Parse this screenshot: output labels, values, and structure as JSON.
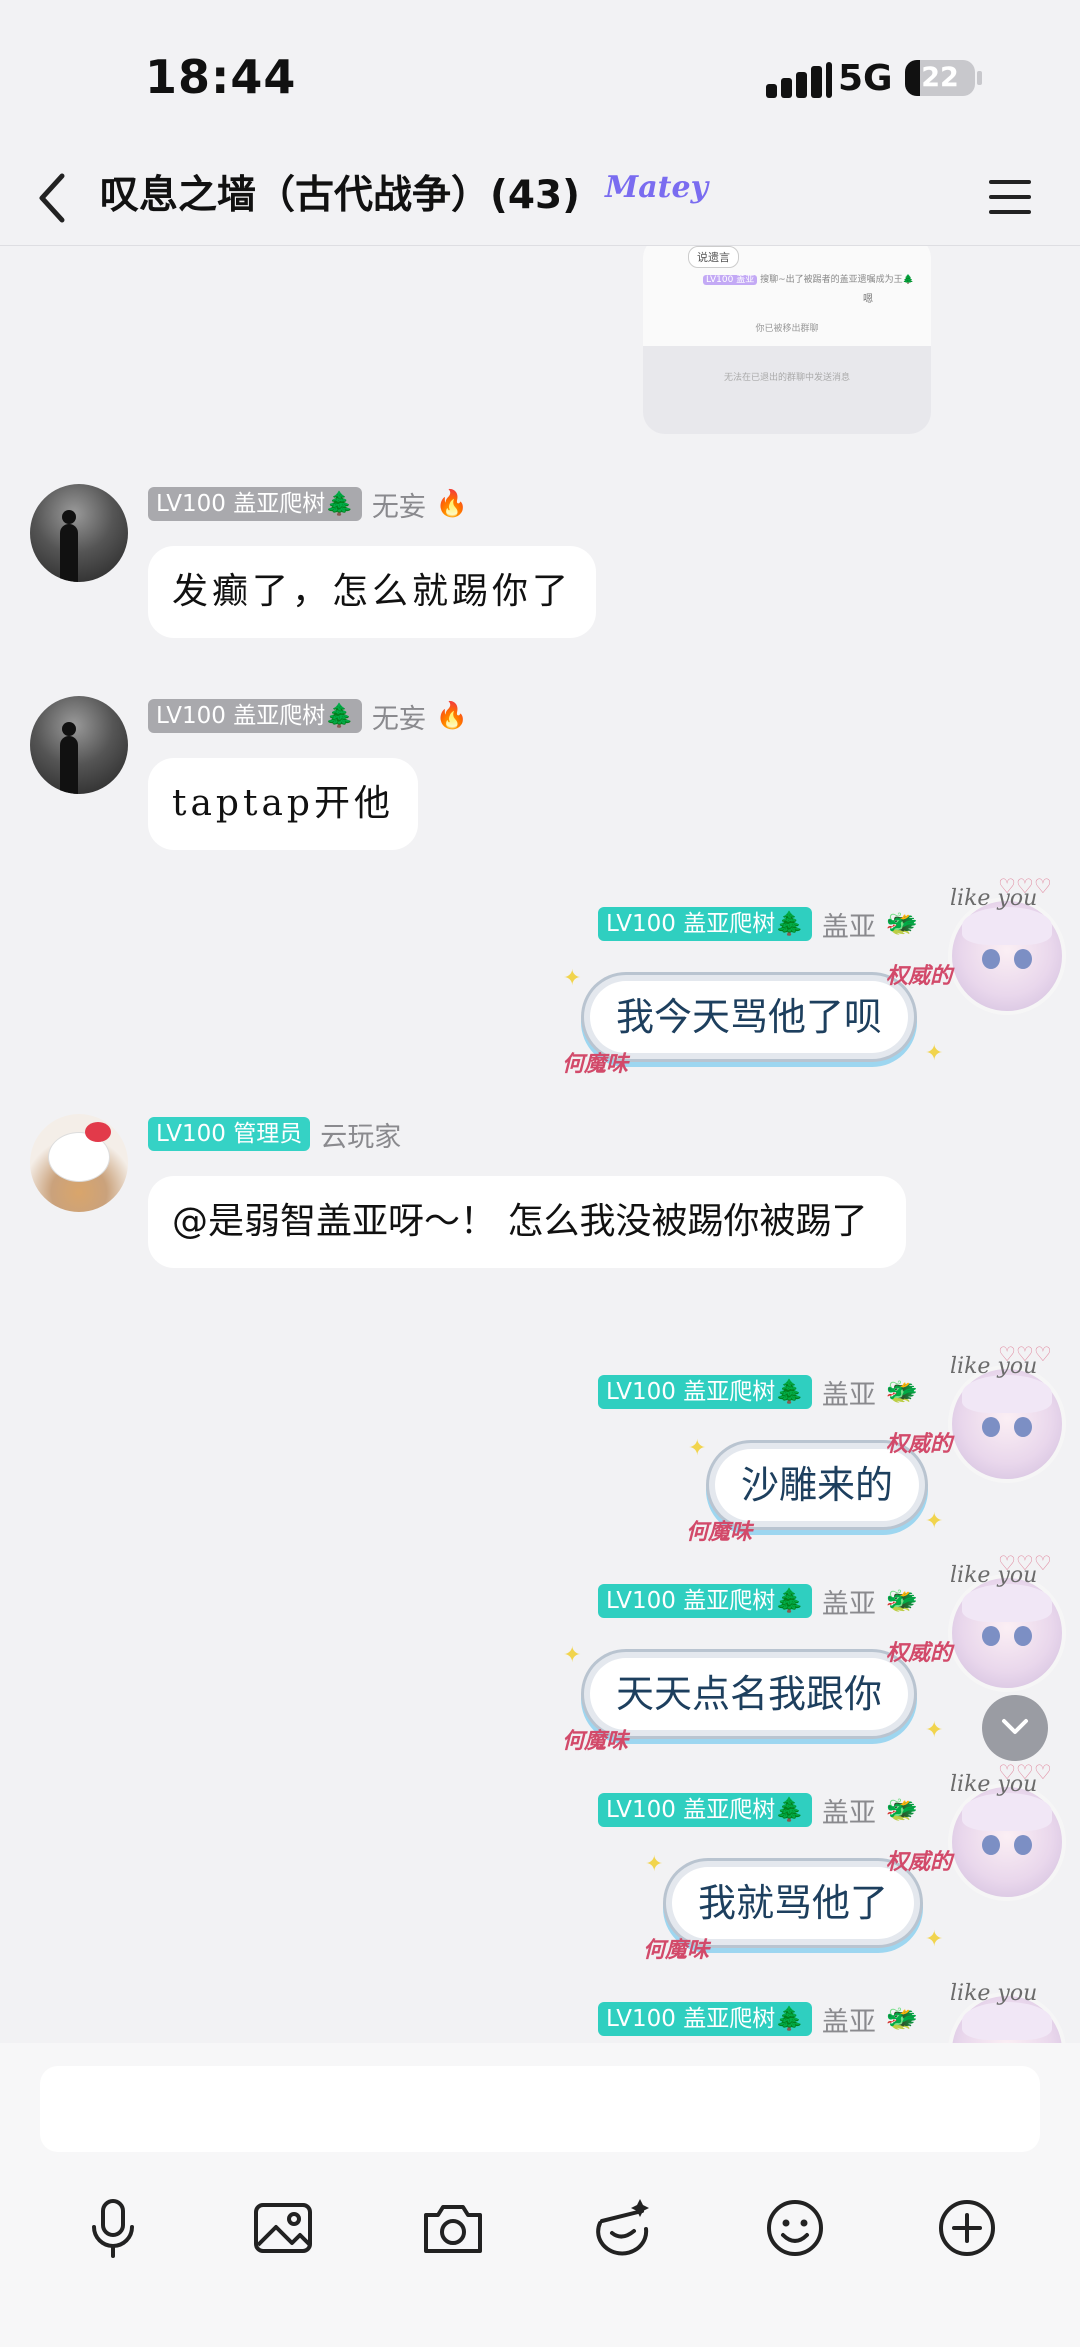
{
  "status_bar": {
    "time": "18:44",
    "network": "5G",
    "battery": "22",
    "battery_level": 0.22
  },
  "header": {
    "title": "叹息之墙（古代战争）(43)",
    "logo_text": "Matey"
  },
  "screenshot_preview": {
    "tag": "说遗言",
    "notice_badge": "LV100 盖亚",
    "notice_text": "搜聊~出了被踢者的盖亚遗嘱成为王🌲",
    "small_tag": "嗯",
    "removed_text": "你已被移出群聊",
    "footer_text": "无法在已退出的群聊中发送消息"
  },
  "messages": [
    {
      "badge": "LV100 盖亚爬树🌲",
      "name": "无妄",
      "text": "发癫了，怎么就踢你了"
    },
    {
      "badge": "LV100 盖亚爬树🌲",
      "name": "无妄",
      "text": "taptap开他"
    },
    {
      "badge": "LV100 盖亚爬树🌲",
      "name": "盖亚",
      "text": "我今天骂他了呗"
    },
    {
      "badge": "LV100 管理员",
      "name": "云玩家",
      "text": "@是弱智盖亚呀～！ 怎么我没被踢你被踢了"
    },
    {
      "badge": "LV100 盖亚爬树🌲",
      "name": "盖亚",
      "text": "沙雕来的"
    },
    {
      "badge": "LV100 盖亚爬树🌲",
      "name": "盖亚",
      "text": "天天点名我跟你"
    },
    {
      "badge": "LV100 盖亚爬树🌲",
      "name": "盖亚",
      "text": "我就骂他了"
    },
    {
      "badge": "LV100 盖亚爬树🌲",
      "name": "盖亚"
    }
  ],
  "bubble_decor": {
    "tag_top": "权威的",
    "tag_bottom": "何魔味",
    "avatar_text": "like you"
  },
  "colors": {
    "badge_teal": "#2fcfc0",
    "badge_gray": "#a9a9ad",
    "background": "#f2f2f4"
  },
  "toolbar_icons": [
    "microphone-icon",
    "image-icon",
    "camera-icon",
    "emoji-edit-icon",
    "smiley-icon",
    "plus-icon"
  ]
}
